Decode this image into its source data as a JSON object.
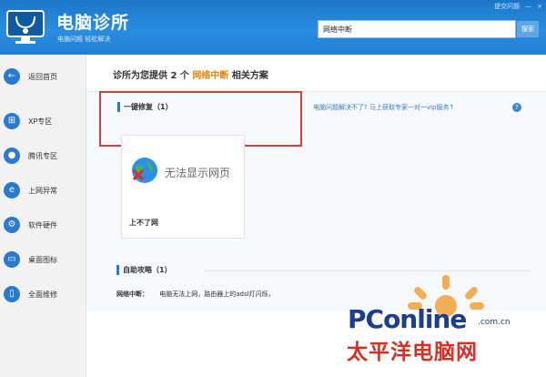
{
  "header": {
    "title": "电脑诊所",
    "slogan": "电脑问题 轻松解决",
    "links": [
      "提交问题",
      "—",
      "×"
    ]
  },
  "search": {
    "value": "网络中断",
    "button": "搜索"
  },
  "sidebar": {
    "items": [
      {
        "label": "返回首页",
        "icon": "back-arrow-icon"
      },
      {
        "label": "XP专区",
        "icon": "windows-xp-icon"
      },
      {
        "label": "腾讯专区",
        "icon": "tencent-icon"
      },
      {
        "label": "上网异常",
        "icon": "ie-browser-icon"
      },
      {
        "label": "软件硬件",
        "icon": "gear-icon"
      },
      {
        "label": "桌面图标",
        "icon": "monitor-icon"
      },
      {
        "label": "全面维修",
        "icon": "phone-icon"
      }
    ]
  },
  "main": {
    "headline_prefix": "诊所为您提供 2 个",
    "headline_keyword": "网络中断",
    "headline_suffix": "相关方案",
    "section1_title": "一键修复（1）",
    "help_link": "电脑问题解决不了? 马上获取专家一对一vip服务↑",
    "card": {
      "error_text": "无法显示网页",
      "title": "上不了网"
    },
    "section2_title": "自助攻略（1）",
    "tip_label": "网络中断：",
    "tip_text": "电脑无法上网，路由器上的adsl灯闪烁，"
  },
  "watermark": {
    "brand": "PConline",
    "domain": ".com.cn",
    "cn": "太平洋电脑网"
  },
  "colors": {
    "header_blue": "#2a8de0",
    "keyword_orange": "#e8830c",
    "highlight_red": "#c9443e"
  }
}
